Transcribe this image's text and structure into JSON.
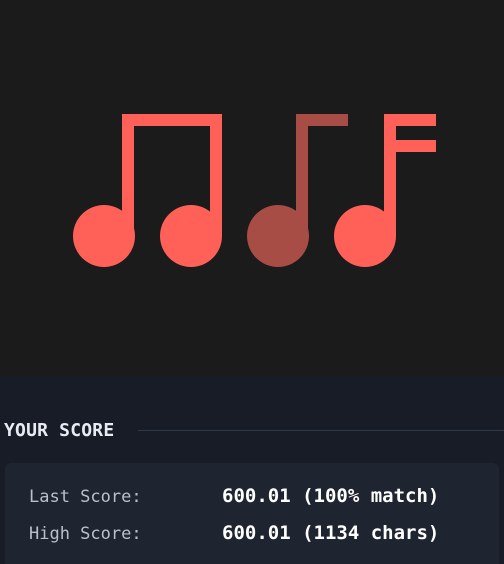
{
  "preview": {
    "background": "#1b1b1b",
    "colors": {
      "note": "#ff6159",
      "note_dim": "#a74d45"
    },
    "icons": [
      "beamed-eighth-notes-icon",
      "eighth-note-icon",
      "eighth-note-flag-icon"
    ]
  },
  "score": {
    "title": "YOUR SCORE",
    "rows": [
      {
        "label": "Last Score:",
        "value": "600.01 (100% match)"
      },
      {
        "label": "High Score:",
        "value": "600.01 (1134 chars)"
      }
    ]
  }
}
